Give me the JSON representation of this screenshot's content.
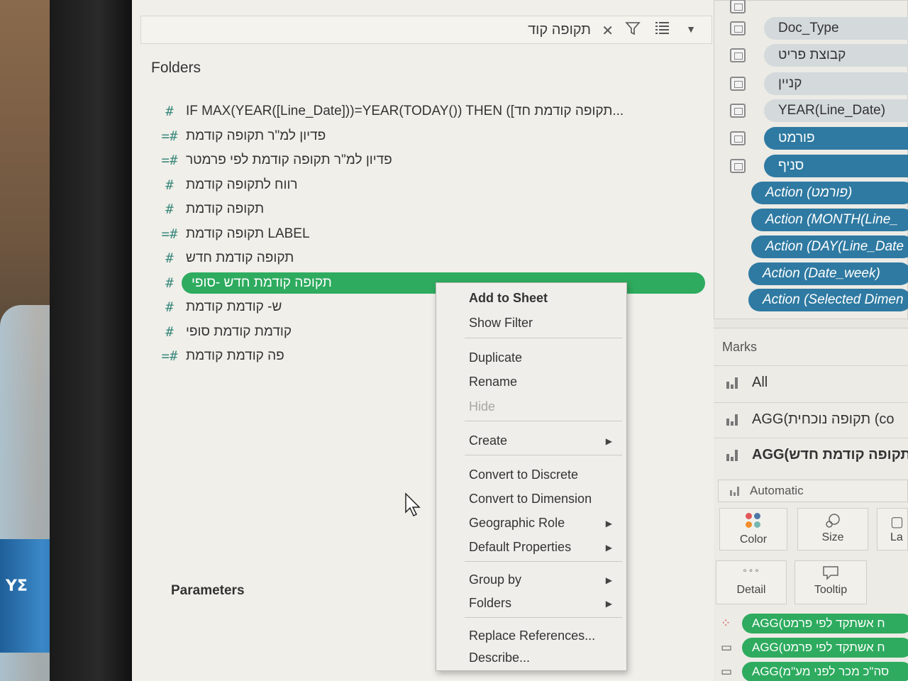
{
  "search": {
    "value": "תקופה קוד"
  },
  "left_pane": {
    "folders_title": "Folders",
    "parameters_title": "Parameters",
    "fields": [
      {
        "icon": "#",
        "label": "IF MAX(YEAR([Line_Date]))=YEAR(TODAY()) THEN ([תקופה קודמת חד..."
      },
      {
        "icon": "=#",
        "label": "פדיון למ\"ר תקופה קודמת"
      },
      {
        "icon": "=#",
        "label": "פדיון למ\"ר תקופה קודמת לפי פרמטר"
      },
      {
        "icon": "#",
        "label": "רווח לתקופה קודמת"
      },
      {
        "icon": "#",
        "label": "תקופה קודמת"
      },
      {
        "icon": "=#",
        "label": "תקופה קודמת LABEL"
      },
      {
        "icon": "#",
        "label": "תקופה קודמת חדש"
      },
      {
        "icon": "#",
        "label": "תקופה קודמת חדש -סופי"
      },
      {
        "icon": "#",
        "label": "ש- קודמת קודמת"
      },
      {
        "icon": "#",
        "label": "קודמת קודמת סופי"
      },
      {
        "icon": "=#",
        "label": "פה קודמת קודמת"
      }
    ]
  },
  "filters": [
    {
      "label": "Doc_Type",
      "style": "grey"
    },
    {
      "label": "קבוצת פריט",
      "style": "grey"
    },
    {
      "label": "קניין",
      "style": "grey"
    },
    {
      "label": "YEAR(Line_Date)",
      "style": "grey"
    },
    {
      "label": "פורמט",
      "style": "blue"
    },
    {
      "label": "סניף",
      "style": "blue"
    },
    {
      "label": "Action (פורמט)",
      "style": "blue"
    },
    {
      "label": "Action (MONTH(Line_",
      "style": "blue"
    },
    {
      "label": "Action (DAY(Line_Date",
      "style": "blue"
    },
    {
      "label": "Action (Date_week)",
      "style": "blue"
    },
    {
      "label": "Action (Selected Dimen",
      "style": "blue"
    }
  ],
  "marks": {
    "title": "Marks",
    "rows": [
      {
        "label": "All"
      },
      {
        "label": "AGG(תקופה נוכחית (co"
      },
      {
        "label": "AGG(תקופה קודמת חדש"
      }
    ],
    "mark_type": "Automatic",
    "cards": {
      "color": "Color",
      "size": "Size",
      "label": "La",
      "detail": "Detail",
      "tooltip": "Tooltip"
    },
    "shelf": [
      {
        "icon": "color-icon",
        "label": "AGG(ח אשתקד לפי פרמט"
      },
      {
        "icon": "tooltip-icon",
        "label": "AGG(ח אשתקד לפי פרמט"
      },
      {
        "icon": "tooltip-icon",
        "label": "AGG(סה\"כ מכר לפני מע\"מ"
      }
    ]
  },
  "context_menu": {
    "add_to_sheet": "Add to Sheet",
    "show_filter": "Show Filter",
    "duplicate": "Duplicate",
    "rename": "Rename",
    "hide": "Hide",
    "create": "Create",
    "convert_to_discrete": "Convert to Discrete",
    "convert_to_dimension": "Convert to Dimension",
    "geographic_role": "Geographic Role",
    "default_properties": "Default Properties",
    "group_by": "Group by",
    "folders": "Folders",
    "replace_references": "Replace References...",
    "describe": "Describe..."
  },
  "colors": {
    "selected_pill": "#2eab5f",
    "filter_blue": "#2f7aa2",
    "filter_grey": "#d4d9dc"
  }
}
